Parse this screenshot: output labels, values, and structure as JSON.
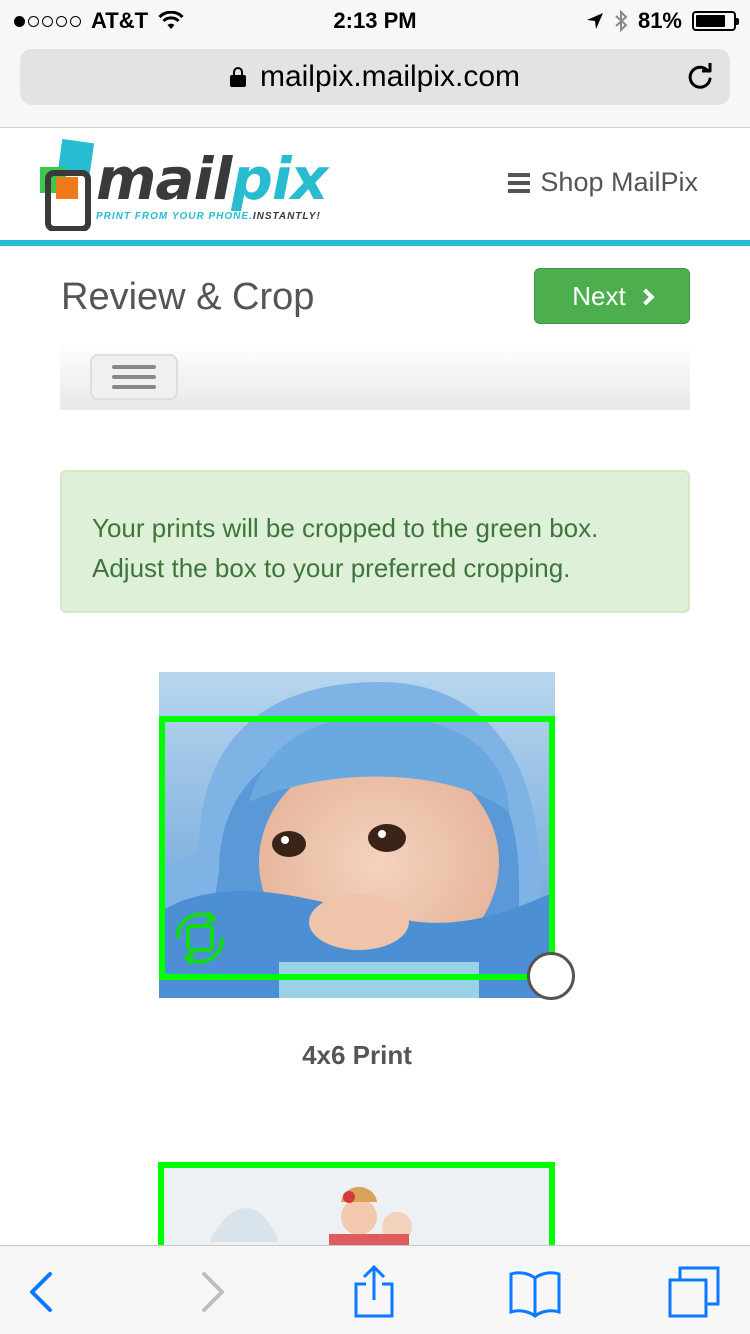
{
  "status_bar": {
    "carrier": "AT&T",
    "time": "2:13 PM",
    "battery_percent": "81%",
    "battery_level": 0.81,
    "signal_bars_filled": 1,
    "signal_bars_total": 5
  },
  "browser": {
    "url": "mailpix.mailpix.com"
  },
  "header": {
    "logo_mail": "mail",
    "logo_pix": "pix",
    "tagline_part1": "PRINT FROM YOUR PHONE.",
    "tagline_part2": "INSTANTLY!",
    "shop_menu_label": "Shop MailPix"
  },
  "page": {
    "title": "Review & Crop",
    "next_label": "Next"
  },
  "alert": {
    "line1": "Your prints will be cropped to the green box.",
    "line2": "Adjust the box to your preferred cropping."
  },
  "photos": [
    {
      "label": "4x6 Print"
    }
  ],
  "colors": {
    "accent_teal": "#28bcd1",
    "next_green": "#4cae4c",
    "crop_green": "#00ff00",
    "alert_bg": "#dff0d8",
    "alert_text": "#3c763d",
    "ios_blue": "#0a7aff"
  },
  "icons": {
    "toolbar": [
      "back-icon",
      "forward-icon",
      "share-icon",
      "bookmarks-icon",
      "tabs-icon"
    ]
  }
}
